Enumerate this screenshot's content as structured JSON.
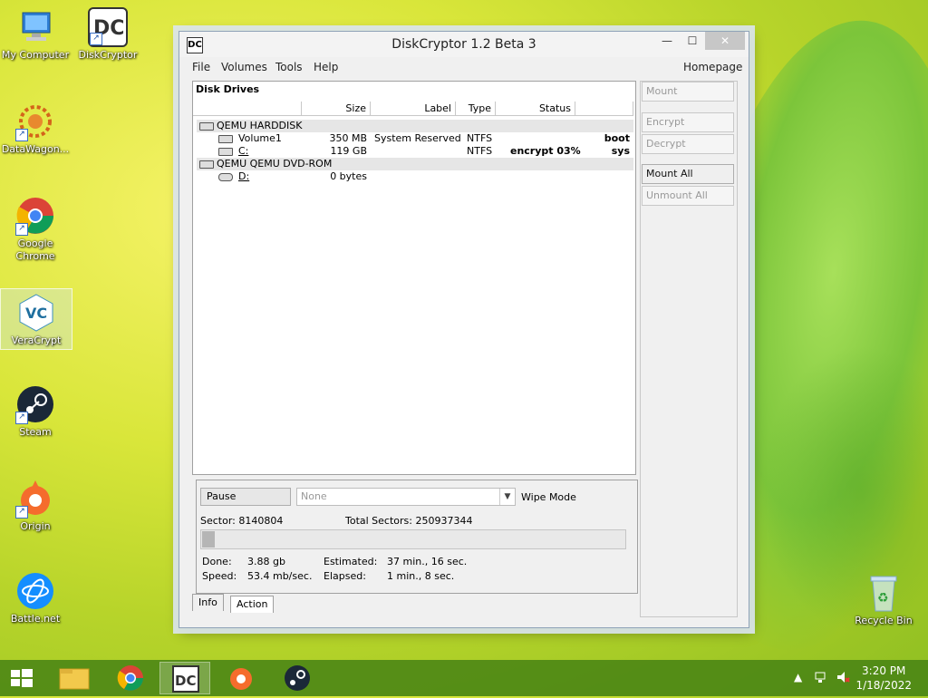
{
  "desktop": {
    "icons": [
      {
        "label": "My Computer"
      },
      {
        "label": "DiskCryptor"
      },
      {
        "label": "DataWagon..."
      },
      {
        "label": "Google Chrome"
      },
      {
        "label": "VeraCrypt"
      },
      {
        "label": "Steam"
      },
      {
        "label": "Origin"
      },
      {
        "label": "Battle.net"
      },
      {
        "label": "Recycle Bin"
      }
    ]
  },
  "window": {
    "title": "DiskCryptor 1.2 Beta 3",
    "app_icon": "DC",
    "min_glyph": "—",
    "max_glyph": "☐",
    "close_glyph": "✕"
  },
  "menu": {
    "file": "File",
    "volumes": "Volumes",
    "tools": "Tools",
    "help": "Help",
    "homepage": "Homepage"
  },
  "drives": {
    "panel_title": "Disk Drives",
    "columns": {
      "size": "Size",
      "label": "Label",
      "type": "Type",
      "status": "Status"
    },
    "groups": [
      {
        "name": "QEMU HARDDISK",
        "volumes": [
          {
            "name": "Volume1",
            "size": "350 MB",
            "label": "System Reserved",
            "type": "NTFS",
            "status": "",
            "flag": "boot"
          },
          {
            "name": "C:",
            "size": "119 GB",
            "label": "",
            "type": "NTFS",
            "status": "encrypt 03%",
            "flag": "sys"
          }
        ]
      },
      {
        "name": "QEMU QEMU DVD-ROM",
        "volumes": [
          {
            "name": "D:",
            "size": "0 bytes",
            "label": "",
            "type": "",
            "status": "",
            "flag": ""
          }
        ]
      }
    ]
  },
  "action": {
    "pause_label": "Pause",
    "wipe_value": "None",
    "wipe_arrow": "▼",
    "wipe_mode_label": "Wipe Mode",
    "sector_label": "Sector: 8140804",
    "total_sectors_label": "Total Sectors: 250937344",
    "progress": 0.03,
    "done_label": "Done:",
    "done_value": "3.88 gb",
    "speed_label": "Speed:",
    "speed_value": "53.4 mb/sec.",
    "estimated_label": "Estimated:",
    "estimated_value": "37 min., 16 sec.",
    "elapsed_label": "Elapsed:",
    "elapsed_value": "1 min., 8 sec."
  },
  "tabs": {
    "info": "Info",
    "action": "Action"
  },
  "side_buttons": {
    "mount": "Mount",
    "encrypt": "Encrypt",
    "decrypt": "Decrypt",
    "mount_all": "Mount All",
    "unmount_all": "Unmount All"
  },
  "taskbar": {
    "time": "3:20 PM",
    "date": "1/18/2022",
    "tray_up": "▲"
  }
}
